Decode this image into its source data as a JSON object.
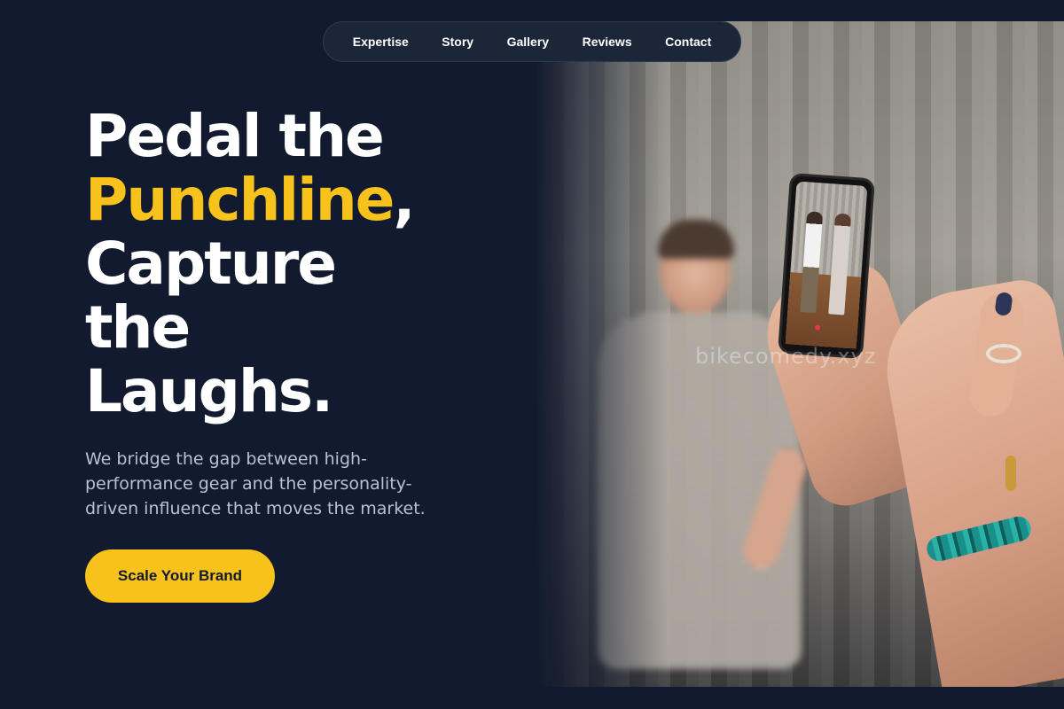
{
  "nav": {
    "items": [
      {
        "label": "Expertise"
      },
      {
        "label": "Story"
      },
      {
        "label": "Gallery"
      },
      {
        "label": "Reviews"
      },
      {
        "label": "Contact"
      }
    ]
  },
  "hero": {
    "title_line1": "Pedal the",
    "title_accent": "Punchline",
    "title_comma": ",",
    "title_line3": "Capture",
    "title_line4": "the",
    "title_line5": "Laughs.",
    "subtitle": "We bridge the gap between high-performance gear and the personality-driven influence that moves the market.",
    "cta_label": "Scale Your Brand"
  },
  "photo": {
    "watermark": "bikecomedy.xyz"
  },
  "colors": {
    "background": "#111a2e",
    "accent": "#f6c21b",
    "nav_bg": "#1c2639",
    "subtitle_text": "#b9c2d3"
  }
}
